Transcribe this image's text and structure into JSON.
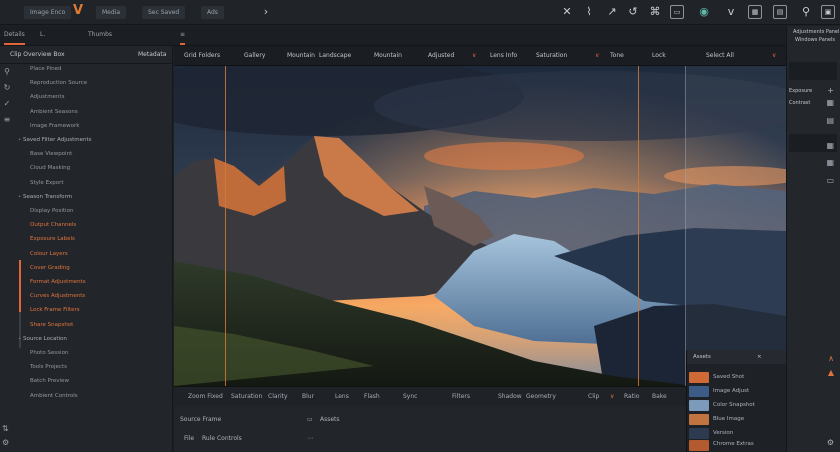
{
  "toolbar": {
    "pill1": "Image Enco",
    "pill2": "Media",
    "pill3": "Sec Saved",
    "pill4": "Ads"
  },
  "tabs": {
    "left": "Details",
    "right": "Thumbs"
  },
  "left_panel": {
    "header": [
      "Clip Overview Box",
      "Metadata"
    ],
    "items": [
      {
        "label": "Place Pined",
        "type": "sub",
        "top": 0
      },
      {
        "label": "Reproduction Source",
        "type": "sub"
      },
      {
        "label": "Adjustments",
        "type": "sub"
      },
      {
        "label": "Ambient Seasons",
        "type": "sub"
      },
      {
        "label": "Image Framework",
        "type": "sub"
      },
      {
        "label": "Saved Filter Adjustments",
        "type": "main"
      },
      {
        "label": "Base Viewpoint",
        "type": "sub"
      },
      {
        "label": "Cloud Masking",
        "type": "sub"
      },
      {
        "label": "Style Export",
        "type": "sub"
      },
      {
        "label": "Season Transform",
        "type": "main"
      },
      {
        "label": "Display Position",
        "type": "sub"
      },
      {
        "label": "Output Channels",
        "type": "sub",
        "orange": true
      },
      {
        "label": "Exposure Labels",
        "type": "sub",
        "orange": true
      },
      {
        "label": "Colour Layers",
        "type": "sub",
        "orange": true
      },
      {
        "label": "Cover Grading",
        "type": "sub",
        "orange": true
      },
      {
        "label": "Format Adjustments",
        "type": "sub",
        "orange": true
      },
      {
        "label": "Curves Adjustments",
        "type": "sub",
        "orange": true
      },
      {
        "label": "Lock Frame Filters",
        "type": "sub",
        "orange": true
      },
      {
        "label": "Share Snapshot",
        "type": "sub",
        "orange": true
      },
      {
        "label": "Source Location",
        "type": "main"
      },
      {
        "label": "Photo Session",
        "type": "sub"
      },
      {
        "label": "Tools Projects",
        "type": "sub"
      },
      {
        "label": "Batch Preview",
        "type": "sub"
      },
      {
        "label": "Ambient Controls",
        "type": "sub"
      }
    ]
  },
  "viewer": {
    "header": [
      "Grid Folders",
      "Gallery",
      "Mountain",
      "Landscape",
      "Mountain",
      "Adjusted",
      "Lens Info",
      "Saturation",
      "Tone",
      "Lock",
      "Select All"
    ]
  },
  "strip": [
    "Zoom Fixed",
    "Saturation",
    "Clarity",
    "Blur",
    "Lens",
    "Flash",
    "Sync",
    "Filters",
    "Shadow",
    "Geometry",
    "Clip",
    "Ratio",
    "Bake",
    "Rule All"
  ],
  "footer": {
    "row1_left": "Source Frame",
    "row1_right": "Assets",
    "row2_left": "File",
    "row2_mid": "Rule Controls"
  },
  "right_panel": {
    "title": [
      "Adjustments Panel",
      "Windows Panels"
    ],
    "labels": [
      "Exposure",
      "Contrast"
    ]
  },
  "film": {
    "header": "Assets",
    "header2": "Histogram",
    "items": [
      "Saved Shot",
      "Image Adjust",
      "Color Snapshot",
      "Blue Image",
      "Version",
      "Chrome Extras"
    ]
  }
}
